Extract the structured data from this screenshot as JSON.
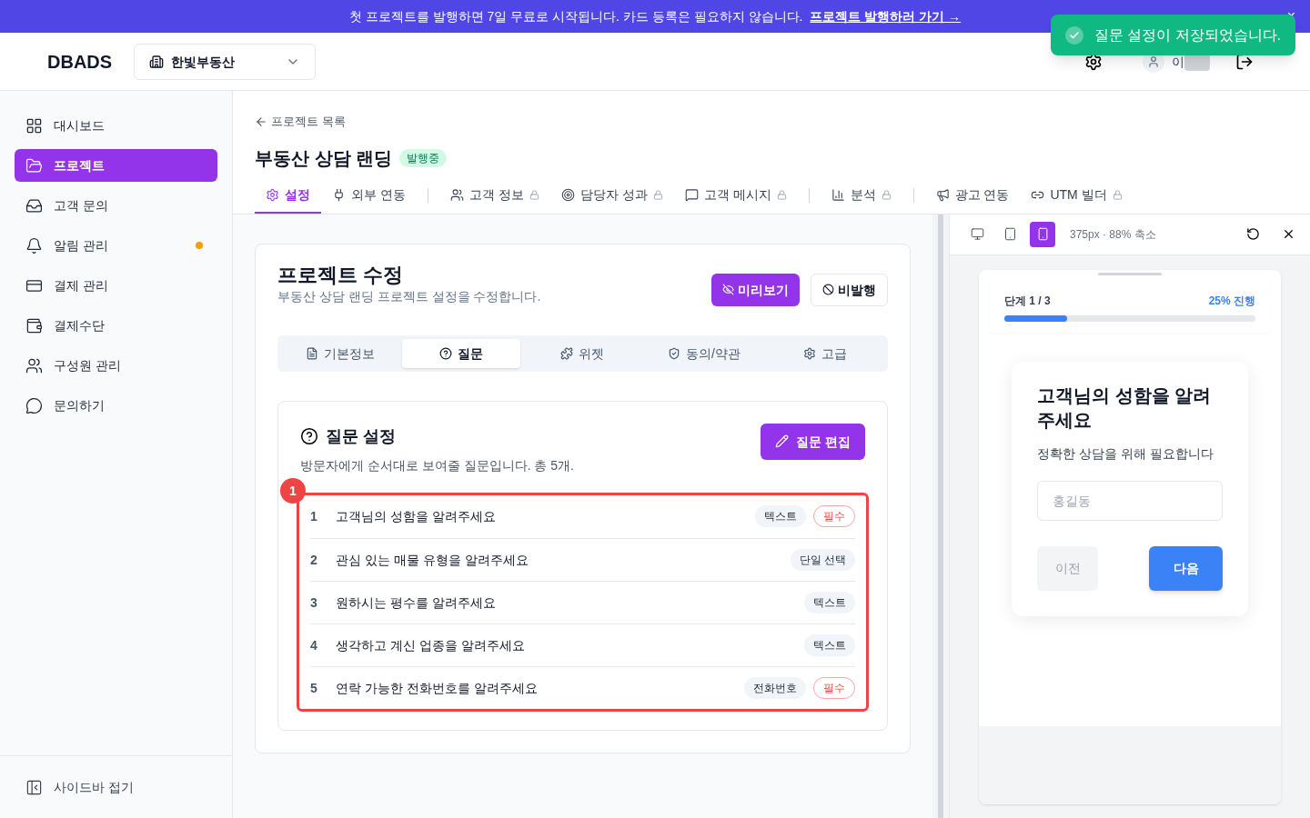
{
  "banner": {
    "text": "첫 프로젝트를 발행하면 7일 무료로 시작됩니다. 카드 등록은 필요하지 않습니다.",
    "link": "프로젝트 발행하러 가기 →",
    "close": "×"
  },
  "toast": {
    "text": "질문 설정이 저장되었습니다."
  },
  "header": {
    "logo": "DBADS",
    "workspace": "한빛부동산",
    "user_name": "이"
  },
  "sidebar": {
    "items": [
      {
        "label": "대시보드",
        "selected": false,
        "dot": false
      },
      {
        "label": "프로젝트",
        "selected": true,
        "dot": false
      },
      {
        "label": "고객 문의",
        "selected": false,
        "dot": false
      },
      {
        "label": "알림 관리",
        "selected": false,
        "dot": true
      },
      {
        "label": "결제 관리",
        "selected": false,
        "dot": false
      },
      {
        "label": "결제수단",
        "selected": false,
        "dot": false
      },
      {
        "label": "구성원 관리",
        "selected": false,
        "dot": false
      },
      {
        "label": "문의하기",
        "selected": false,
        "dot": false
      }
    ],
    "collapse": "사이드바 접기"
  },
  "breadcrumb": "프로젝트 목록",
  "project": {
    "title": "부동산 상담 랜딩",
    "status": "발행중"
  },
  "tab_groups": [
    [
      {
        "label": "설정",
        "selected": true,
        "locked": false
      },
      {
        "label": "외부 연동",
        "selected": false,
        "locked": false
      }
    ],
    [
      {
        "label": "고객 정보",
        "selected": false,
        "locked": true
      },
      {
        "label": "담당자 성과",
        "selected": false,
        "locked": true
      },
      {
        "label": "고객 메시지",
        "selected": false,
        "locked": true
      }
    ],
    [
      {
        "label": "분석",
        "selected": false,
        "locked": true
      }
    ],
    [
      {
        "label": "광고 연동",
        "selected": false,
        "locked": false
      },
      {
        "label": "UTM 빌더",
        "selected": false,
        "locked": true
      }
    ]
  ],
  "edit": {
    "title": "프로젝트 수정",
    "subtitle": "부동산 상담 랜딩 프로젝트 설정을 수정합니다.",
    "preview_button": "미리보기",
    "unpublish_button": "비발행",
    "tabs": [
      {
        "label": "기본정보",
        "selected": false
      },
      {
        "label": "질문",
        "selected": true
      },
      {
        "label": "위젯",
        "selected": false
      },
      {
        "label": "동의/약관",
        "selected": false
      },
      {
        "label": "고급",
        "selected": false
      }
    ]
  },
  "questions": {
    "title": "질문 설정",
    "description": "방문자에게 순서대로 보여줄 질문입니다. 총 5개.",
    "edit_button": "질문 편집",
    "highlight_label": "1",
    "rows": [
      {
        "number": "1",
        "text": "고객님의 성함을 알려주세요",
        "type": "텍스트",
        "required": true,
        "required_label": "필수"
      },
      {
        "number": "2",
        "text": "관심 있는 매물 유형을 알려주세요",
        "type": "단일 선택",
        "required": false
      },
      {
        "number": "3",
        "text": "원하시는 평수를 알려주세요",
        "type": "텍스트",
        "required": false
      },
      {
        "number": "4",
        "text": "생각하고 계신 업종을 알려주세요",
        "type": "텍스트",
        "required": false
      },
      {
        "number": "5",
        "text": "연락 가능한 전화번호를 알려주세요",
        "type": "전화번호",
        "required": true,
        "required_label": "필수"
      }
    ]
  },
  "preview": {
    "devices": [
      {
        "kind": "desktop",
        "selected": false
      },
      {
        "kind": "tablet",
        "selected": false
      },
      {
        "kind": "mobile",
        "selected": true
      }
    ],
    "size_label": "375px · 88% 축소",
    "step": "단계 1 / 3",
    "progress_text": "25% 진행",
    "level": 0.25,
    "question": "고객님의 성함을 알려주세요",
    "hint": "정확한 상담을 위해 필요합니다",
    "placeholder": "홍길동",
    "prev_button": "이전",
    "next_button": "다음"
  }
}
